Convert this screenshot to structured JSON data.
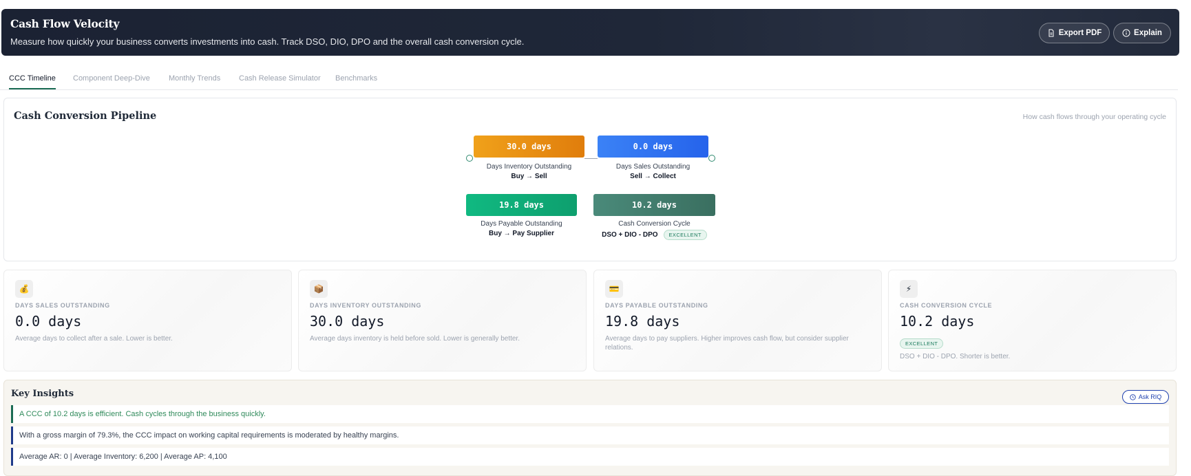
{
  "header": {
    "title": "Cash Flow Velocity",
    "subtitle": "Measure how quickly your business converts investments into cash. Track DSO, DIO, DPO and the overall cash conversion cycle.",
    "export_label": "Export PDF",
    "explain_label": "Explain"
  },
  "tabs": [
    {
      "label": "CCC Timeline",
      "active": true
    },
    {
      "label": "Component Deep-Dive"
    },
    {
      "label": "Monthly Trends"
    },
    {
      "label": "Cash Release Simulator"
    },
    {
      "label": "Benchmarks"
    }
  ],
  "pipeline": {
    "title": "Cash Conversion Pipeline",
    "hint": "How cash flows through your operating cycle",
    "dio": {
      "value": "30.0 days",
      "label": "Days Inventory Outstanding",
      "sub": "Buy → Sell"
    },
    "dso": {
      "value": "0.0 days",
      "label": "Days Sales Outstanding",
      "sub": "Sell → Collect"
    },
    "dpo": {
      "value": "19.8 days",
      "label": "Days Payable Outstanding",
      "sub": "Buy → Pay Supplier"
    },
    "ccc": {
      "value": "10.2 days",
      "label": "Cash Conversion Cycle",
      "sub": "DSO + DIO - DPO",
      "badge": "EXCELLENT"
    }
  },
  "cards": [
    {
      "icon": "money-bag-icon",
      "glyph": "💰",
      "label": "DAYS SALES OUTSTANDING",
      "value": "0.0 days",
      "desc": "Average days to collect after a sale. Lower is better."
    },
    {
      "icon": "package-icon",
      "glyph": "📦",
      "label": "DAYS INVENTORY OUTSTANDING",
      "value": "30.0 days",
      "desc": "Average days inventory is held before sold. Lower is generally better."
    },
    {
      "icon": "credit-card-icon",
      "glyph": "💳",
      "label": "DAYS PAYABLE OUTSTANDING",
      "value": "19.8 days",
      "desc": "Average days to pay suppliers. Higher improves cash flow, but consider supplier relations."
    },
    {
      "icon": "lightning-icon",
      "glyph": "⚡",
      "label": "CASH CONVERSION CYCLE",
      "value": "10.2 days",
      "badge": "EXCELLENT",
      "desc": "DSO + DIO - DPO. Shorter is better."
    }
  ],
  "insights": {
    "title": "Key Insights",
    "ask_label": "Ask RIQ",
    "rows": [
      "A CCC of 10.2 days is efficient. Cash cycles through the business quickly.",
      "With a gross margin of 79.3%, the CCC impact on working capital requirements is moderated by healthy margins.",
      "Average AR: 0 | Average Inventory: 6,200 | Average AP: 4,100"
    ]
  }
}
